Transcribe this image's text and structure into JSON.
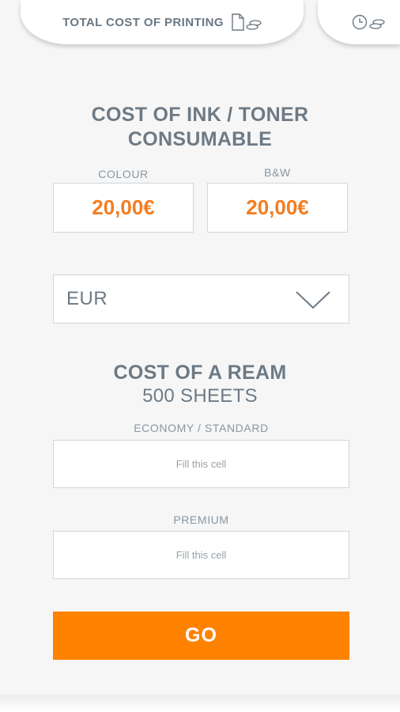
{
  "tabs": {
    "main_label": "TOTAL COST OF PRINTING",
    "main_icons": [
      "document-icon",
      "coins-icon"
    ],
    "alt_icons": [
      "clock-icon",
      "coins-icon"
    ]
  },
  "ink_section": {
    "title_line1": "COST OF INK / TONER",
    "title_line2": "CONSUMABLE",
    "colour_label": "COLOUR",
    "colour_value": "20,00€",
    "bw_label": "B&W",
    "bw_value": "20,00€"
  },
  "currency": {
    "selected": "EUR",
    "icon": "chevron-down-icon"
  },
  "ream_section": {
    "title": "COST OF A REAM",
    "subtitle": "500 SHEETS",
    "economy_label": "ECONOMY / STANDARD",
    "economy_placeholder": "Fill this cell",
    "premium_label": "PREMIUM",
    "premium_placeholder": "Fill this cell"
  },
  "go_button": {
    "label": "GO"
  },
  "colors": {
    "accent": "#ff8200",
    "value_orange": "#f47d20",
    "text_grey": "#6d7a85",
    "background": "#f6f6f6"
  }
}
